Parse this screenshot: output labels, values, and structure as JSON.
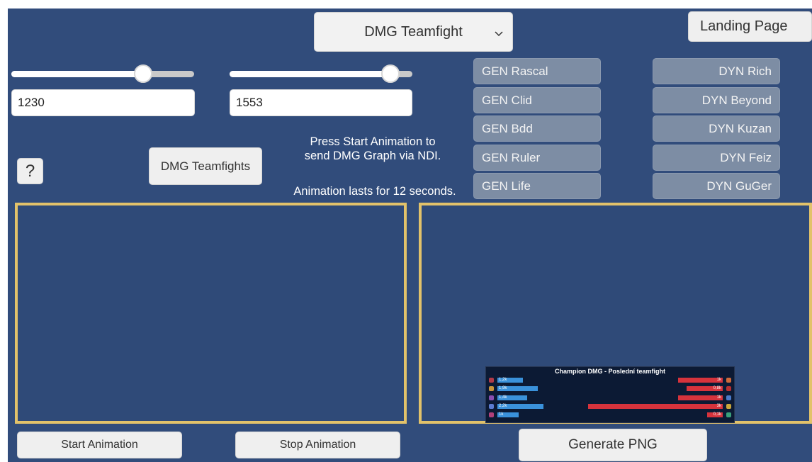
{
  "dropdown": {
    "selected": "DMG Teamfight",
    "chevron": "chevron-down-icon"
  },
  "landing_page_label": "Landing Page",
  "slider_left": {
    "value_fraction": 0.72
  },
  "slider_right": {
    "value_fraction": 0.88
  },
  "input_left": {
    "value": "1230"
  },
  "input_right": {
    "value": "1553"
  },
  "help_label": "?",
  "dmg_teamfights_label": "DMG Teamfights",
  "info": {
    "line1": "Press Start Animation to",
    "line2": "send DMG Graph via NDI.",
    "line3": "Animation lasts for 12 seconds."
  },
  "gen_players": [
    "GEN Rascal",
    "GEN Clid",
    "GEN Bdd",
    "GEN Ruler",
    "GEN Life"
  ],
  "dyn_players": [
    "DYN Rich",
    "DYN Beyond",
    "DYN Kuzan",
    "DYN Feiz",
    "DYN GuGer"
  ],
  "preview": {
    "title": "Champion DMG - Poslední teamfight",
    "rows": [
      {
        "left": "1,2k",
        "left_value": 1.2,
        "right": "1k",
        "right_value": 1.0
      },
      {
        "left": "1,9k",
        "left_value": 1.9,
        "right": "0,8k",
        "right_value": 0.8
      },
      {
        "left": "1,4k",
        "left_value": 1.4,
        "right": "1k",
        "right_value": 1.0
      },
      {
        "left": "2,2k",
        "left_value": 2.2,
        "right": "3k",
        "right_value": 3.0
      },
      {
        "left": "1k",
        "left_value": 1.0,
        "right": "0,1k",
        "right_value": 0.1
      }
    ],
    "colors": {
      "blue": "#3a91da",
      "red": "#d6333c"
    }
  },
  "start_label": "Start Animation",
  "stop_label": "Stop Animation",
  "generate_label": "Generate PNG",
  "colors": {
    "background": "#314c7b",
    "panel_border": "#e2c26a",
    "player_button": "#7d8da4"
  }
}
